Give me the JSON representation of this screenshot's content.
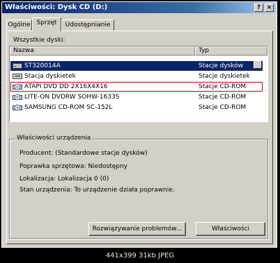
{
  "window": {
    "title": "Właściwości: Dysk CD (D:)",
    "help_label": "?",
    "close_label": "×"
  },
  "tabs": [
    {
      "label": "Ogólne"
    },
    {
      "label": "Sprzęt",
      "active": true
    },
    {
      "label": "Udostępnianie"
    }
  ],
  "devices": {
    "section_label": "Wszystkie dyski:",
    "columns": [
      "Nazwa",
      "Typ"
    ],
    "rows": [
      {
        "name": "ST320014A",
        "type": "Stacje dysków",
        "icon": "hard-disk-icon",
        "selected": true
      },
      {
        "name": "Stacja dyskietek",
        "type": "Stacje dyskietek",
        "icon": "floppy-drive-icon"
      },
      {
        "name": "ATAPI DVD DD 2X16X4X16",
        "type": "Stacje CD-ROM",
        "icon": "cdrom-drive-icon",
        "focused": true
      },
      {
        "name": "LITE-ON DVDRW SOHW-1633S",
        "type": "Stacje CD-ROM",
        "icon": "cdrom-drive-icon"
      },
      {
        "name": "SAMSUNG CD-ROM SC-152L",
        "type": "Stacje CD-ROM",
        "icon": "cdrom-drive-icon"
      }
    ]
  },
  "properties": {
    "title": "Właściwości urządzenia",
    "producer": "Producent: (Standardowe stacje dysków)",
    "revision": "Poprawka sprzętowa: Niedostępny",
    "location": "Lokalizacja: Lokalizacja 0 (0)",
    "status": "Stan urządzenia: To urządzenie działa poprawnie."
  },
  "buttons": {
    "troubleshoot": "Rozwiązywanie problemów...",
    "properties": "Właściwości"
  },
  "caption": "441x399 31kb JPEG"
}
